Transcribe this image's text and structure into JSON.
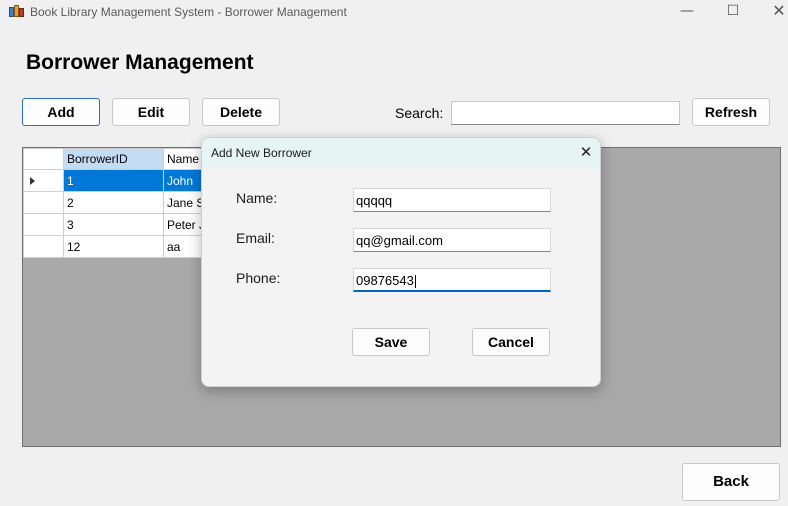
{
  "window": {
    "title": "Book Library Management System - Borrower Management",
    "minimize": "—",
    "maximize": "☐",
    "close": "✕"
  },
  "page": {
    "title": "Borrower Management"
  },
  "toolbar": {
    "add_label": "Add",
    "edit_label": "Edit",
    "delete_label": "Delete",
    "search_label": "Search:",
    "search_value": "",
    "refresh_label": "Refresh"
  },
  "grid": {
    "columns": [
      "BorrowerID",
      "Name"
    ],
    "rows": [
      {
        "id": "1",
        "name": "John"
      },
      {
        "id": "2",
        "name": "Jane Sm"
      },
      {
        "id": "3",
        "name": "Peter Jo"
      },
      {
        "id": "12",
        "name": "aa"
      }
    ],
    "selected_row": 0
  },
  "dialog": {
    "title": "Add New Borrower",
    "close": "✕",
    "name_label": "Name:",
    "name_value": "qqqqq",
    "email_label": "Email:",
    "email_value": "qq@gmail.com",
    "phone_label": "Phone:",
    "phone_value": "09876543",
    "save_label": "Save",
    "cancel_label": "Cancel"
  },
  "footer": {
    "back_label": "Back"
  },
  "colors": {
    "selection": "#0078d7",
    "focus_border": "#2a6fc9",
    "grid_background": "#a9a9a9",
    "dialog_titlebar": "#e6f4f4"
  }
}
